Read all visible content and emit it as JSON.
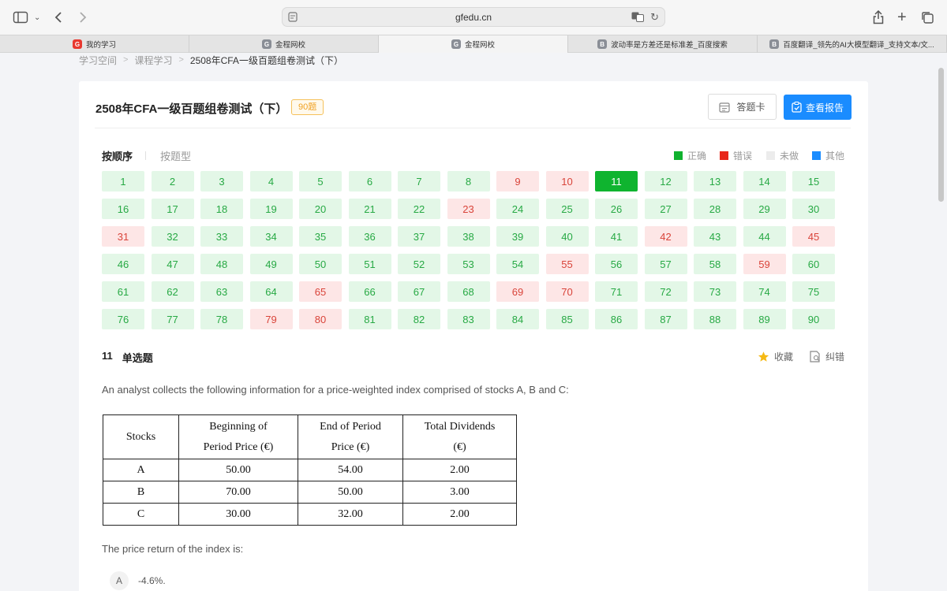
{
  "browser": {
    "url": "gfedu.cn",
    "tabs": [
      {
        "label": "我的学习",
        "favicon": "G",
        "active": false
      },
      {
        "label": "金程网校",
        "favicon": "G",
        "active": false
      },
      {
        "label": "金程网校",
        "favicon": "G",
        "active": true
      },
      {
        "label": "波动率是方差还是标准差_百度搜索",
        "favicon": "B",
        "active": false
      },
      {
        "label": "百度翻译_领先的AI大模型翻译_支持文本/文...",
        "favicon": "B",
        "active": false
      }
    ]
  },
  "breadcrumb": [
    "学习空间",
    "课程学习",
    "2508年CFA一级百题组卷测试（下）"
  ],
  "exam": {
    "title": "2508年CFA一级百题组卷测试（下）",
    "count_badge": "90题",
    "answer_sheet_label": "答题卡",
    "report_label": "查看报告",
    "order_tabs": [
      "按顺序",
      "按题型"
    ],
    "legend": [
      {
        "label": "正确",
        "color": "#10b22f"
      },
      {
        "label": "错误",
        "color": "#e8261a"
      },
      {
        "label": "未做",
        "color": "#ececec"
      },
      {
        "label": "其他",
        "color": "#1a8cff"
      }
    ],
    "wrong": [
      9,
      10,
      23,
      31,
      42,
      45,
      55,
      59,
      65,
      69,
      70,
      79,
      80
    ],
    "current": 11,
    "total": 90
  },
  "question": {
    "number": "11",
    "type": "单选题",
    "favorite_label": "收藏",
    "report_error_label": "纠错",
    "text": "An analyst collects the following information for a price-weighted index comprised of stocks A, B and C:",
    "table": {
      "headers": [
        [
          "Stocks"
        ],
        [
          "Beginning of",
          "Period Price (€)"
        ],
        [
          "End of Period",
          "Price (€)"
        ],
        [
          "Total Dividends",
          "(€)"
        ]
      ],
      "rows": [
        [
          "A",
          "50.00",
          "54.00",
          "2.00"
        ],
        [
          "B",
          "70.00",
          "50.00",
          "3.00"
        ],
        [
          "C",
          "30.00",
          "32.00",
          "2.00"
        ]
      ]
    },
    "prompt": "The price return of the index is:",
    "options": [
      {
        "letter": "A",
        "text": "-4.6%."
      }
    ]
  }
}
